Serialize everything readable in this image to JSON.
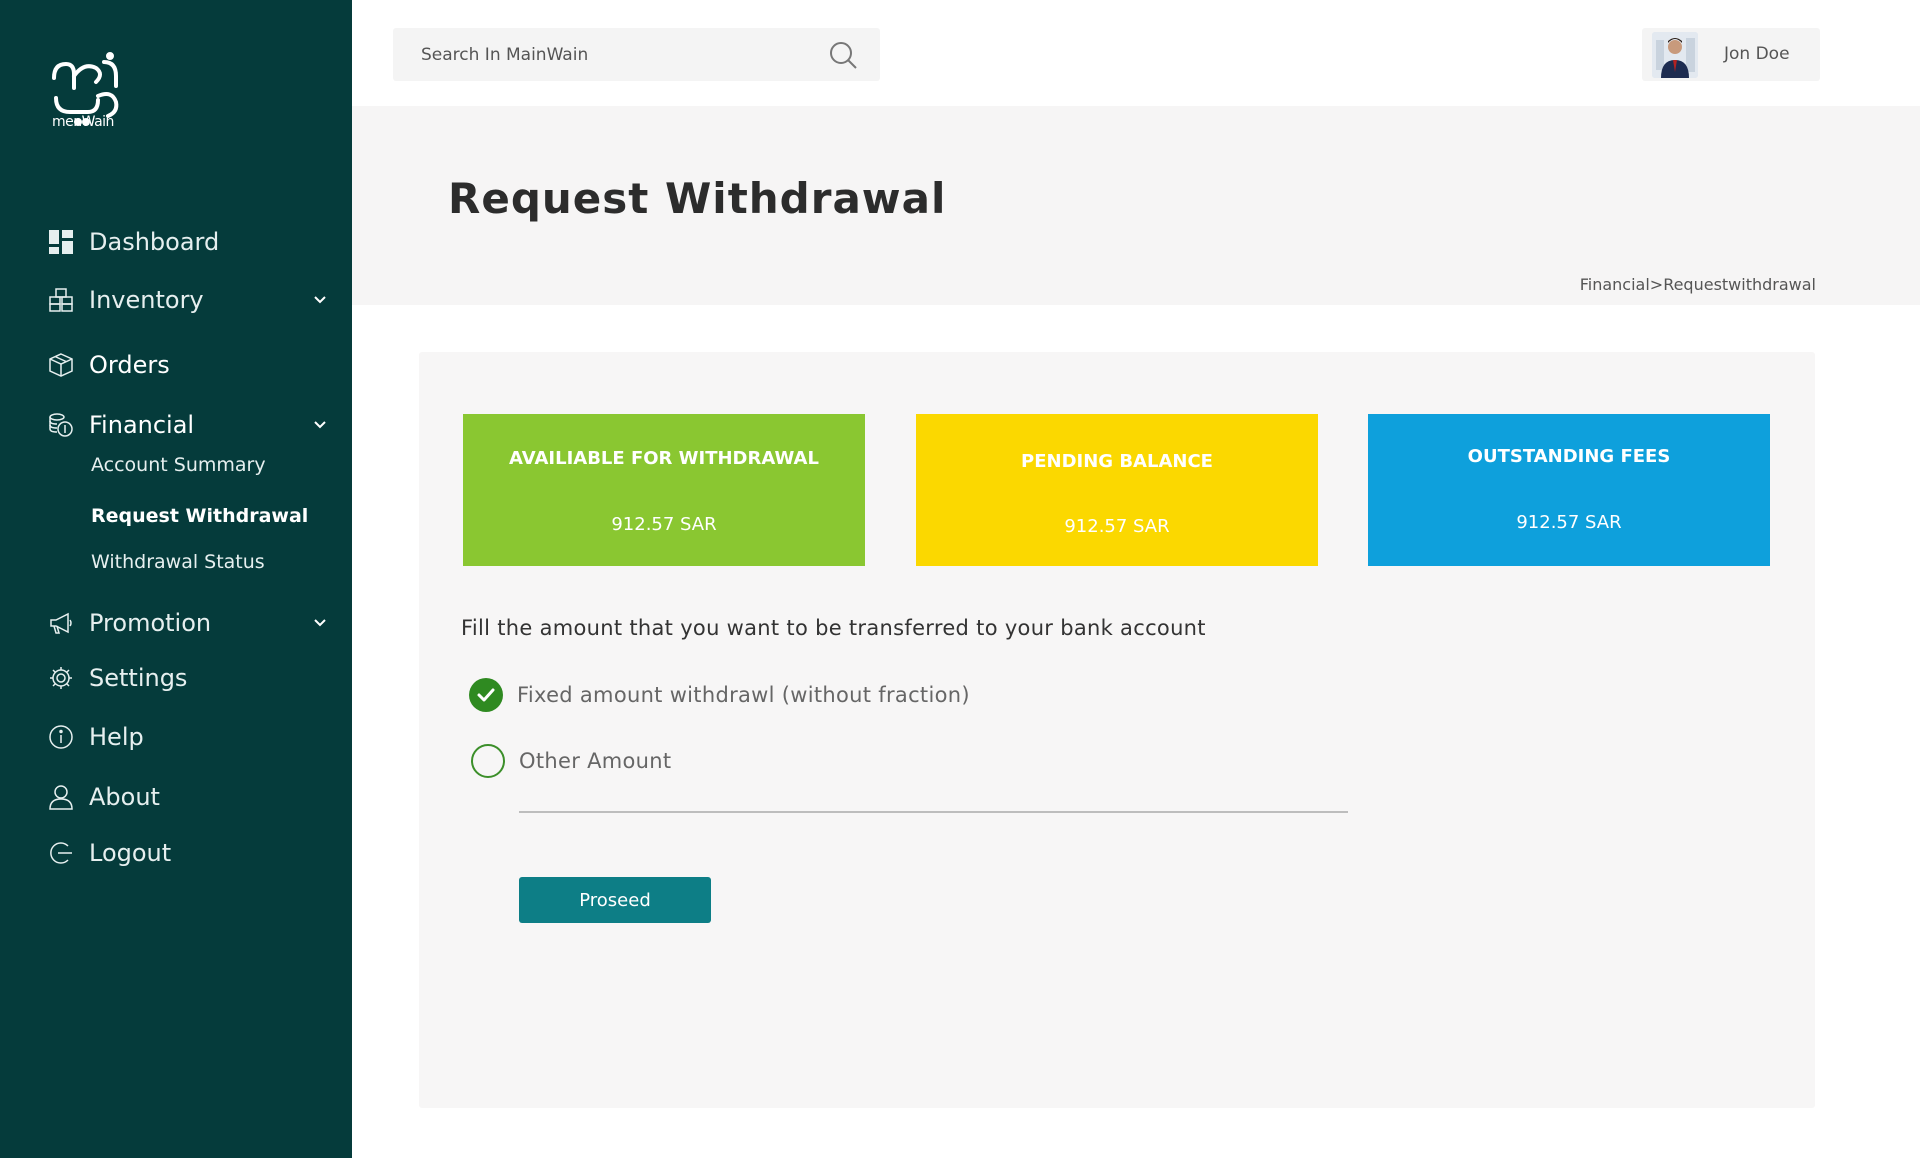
{
  "brand": {
    "logo_text": "menWain"
  },
  "search": {
    "placeholder": "Search In MainWain"
  },
  "user": {
    "name": "Jon Doe"
  },
  "sidebar": {
    "items": [
      {
        "label": "Dashboard"
      },
      {
        "label": "Inventory"
      },
      {
        "label": "Orders"
      },
      {
        "label": "Financial"
      },
      {
        "label": "Promotion"
      },
      {
        "label": "Settings"
      },
      {
        "label": "Help"
      },
      {
        "label": "About"
      },
      {
        "label": "Logout"
      }
    ],
    "financial_sub": [
      {
        "label": "Account Summary"
      },
      {
        "label": "Request Withdrawal"
      },
      {
        "label": "Withdrawal Status"
      }
    ]
  },
  "page": {
    "title": "Request Withdrawal",
    "breadcrumb": "Financial>Requestwithdrawal"
  },
  "cards": [
    {
      "title": "AVAILIABLE FOR WITHDRAWAL",
      "value": "912.57 SAR",
      "color": "#8ac731"
    },
    {
      "title": "PENDING BALANCE",
      "value": "912.57 SAR",
      "color": "#fbd800"
    },
    {
      "title": "OUTSTANDING FEES",
      "value": "912.57 SAR",
      "color": "#0ea0dc"
    }
  ],
  "form": {
    "instruction": "Fill the amount that you want to be transferred to your bank account",
    "option_fixed": "Fixed amount withdrawl (without fraction)",
    "option_other": "Other Amount",
    "amount_value": "",
    "proceed_label": "Proseed"
  },
  "colors": {
    "sidebar": "#053b3b",
    "accent": "#0d7e86",
    "radio": "#2f8a21"
  }
}
